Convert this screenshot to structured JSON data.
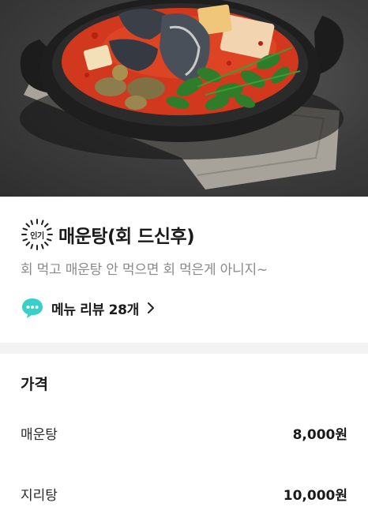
{
  "hero_image": {
    "alt_icon": "maeuntang-photo"
  },
  "header": {
    "badge_label": "인기",
    "title": "매운탕(회 드신후)",
    "description": "회 먹고 매운탕 안 먹으면 회 먹은게 아니지~",
    "review_link": "메뉴 리뷰 28개",
    "review_icon": "speech-bubble-icon",
    "chevron_icon": "chevron-right-icon"
  },
  "prices": {
    "heading": "가격",
    "items": [
      {
        "name": "매운탕",
        "price": "8,000원"
      },
      {
        "name": "지리탕",
        "price": "10,000원"
      }
    ]
  },
  "colors": {
    "bubble": "#38d0c8",
    "soup": "#d2381e",
    "pot": "#1c1c1c",
    "divider": "#f3f3f3"
  }
}
